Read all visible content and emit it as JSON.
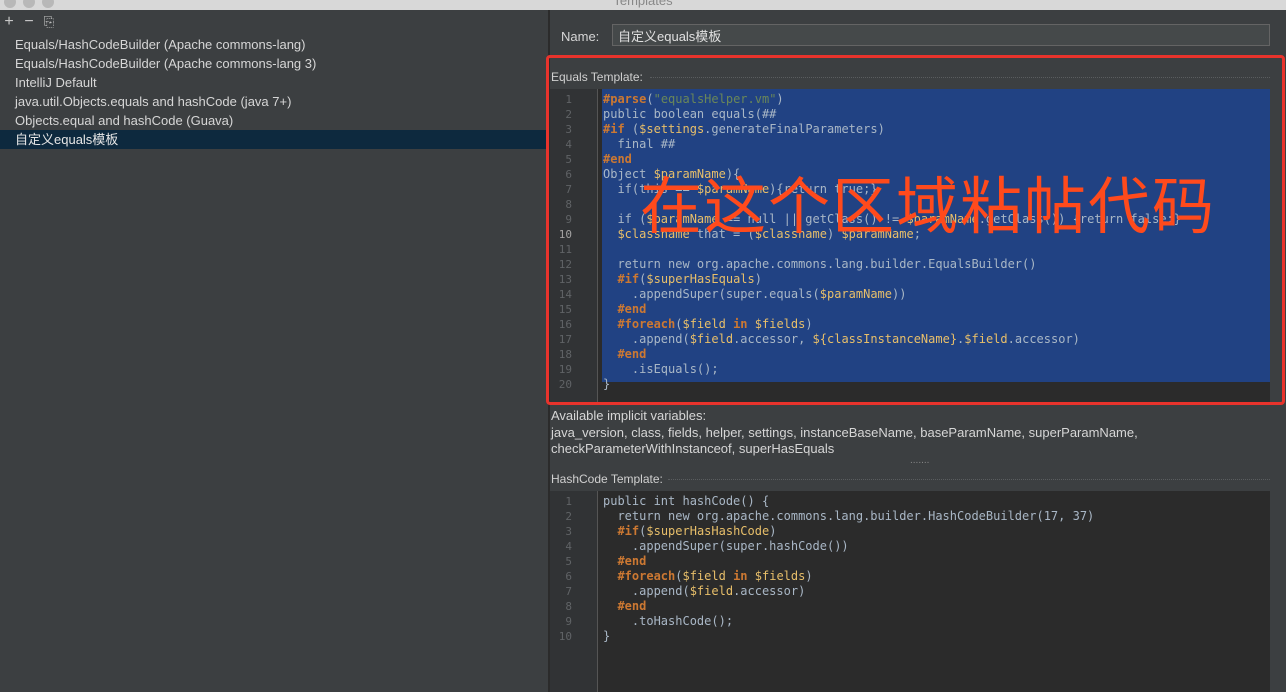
{
  "window": {
    "title": "Templates"
  },
  "toolbar": {
    "add": "+",
    "remove": "−",
    "copy": "⎘"
  },
  "templates": [
    "Equals/HashCodeBuilder (Apache commons-lang)",
    "Equals/HashCodeBuilder (Apache commons-lang 3)",
    "IntelliJ Default",
    "java.util.Objects.equals and hashCode (java 7+)",
    "Objects.equal and hashCode (Guava)",
    "自定义equals模板"
  ],
  "selected_index": 5,
  "name": {
    "label": "Name:",
    "value": "自定义equals模板"
  },
  "equals": {
    "label": "Equals Template:",
    "current_line": 10,
    "lines": [
      "#parse(\"equalsHelper.vm\")",
      "public boolean equals(##",
      "#if ($settings.generateFinalParameters)",
      "  final ##",
      "#end",
      "Object $paramName){",
      "  if(this == $paramName){return true;}",
      "",
      "  if ($paramName == null || getClass() != $paramName.getClass()) {return false;}",
      "  $classname that = ($classname) $paramName;",
      "",
      "  return new org.apache.commons.lang.builder.EqualsBuilder()",
      "  #if($superHasEquals)",
      "    .appendSuper(super.equals($paramName))",
      "  #end",
      "  #foreach($field in $fields)",
      "    .append($field.accessor, ${classInstanceName}.$field.accessor)",
      "  #end",
      "    .isEquals();",
      "}"
    ]
  },
  "implicit": {
    "title": "Available implicit variables:",
    "line1": "java_version, class, fields, helper, settings, instanceBaseName, baseParamName, superParamName,",
    "line2": "checkParameterWithInstanceof, superHasEquals"
  },
  "hashcode": {
    "label": "HashCode Template:",
    "lines": [
      "public int hashCode() {",
      "  return new org.apache.commons.lang.builder.HashCodeBuilder(17, 37)",
      "  #if($superHasHashCode)",
      "    .appendSuper(super.hashCode())",
      "  #end",
      "  #foreach($field in $fields)",
      "    .append($field.accessor)",
      "  #end",
      "    .toHashCode();",
      "}"
    ]
  },
  "overlay_text": "在这个区域粘帖代码",
  "colors": {
    "selection": "#214283",
    "annotation": "#e8332c",
    "keyword": "#cc7832",
    "variable": "#e8bf6a",
    "string": "#6a8759"
  }
}
